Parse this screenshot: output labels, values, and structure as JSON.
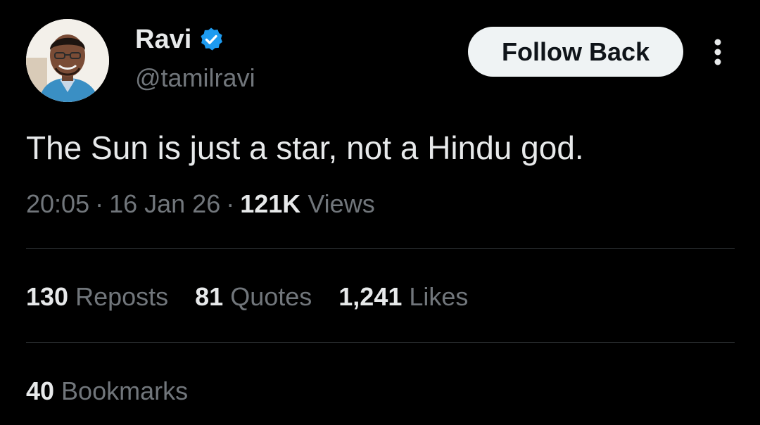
{
  "author": {
    "name": "Ravi",
    "handle": "@tamilravi",
    "verified_icon": "verified-badge-icon",
    "verified_color": "#1d9bf0"
  },
  "actions": {
    "follow_label": "Follow Back",
    "more_icon": "more-vertical-icon"
  },
  "tweet": {
    "text": "The Sun is just a star, not a Hindu god.",
    "time": "20:05",
    "date": "16 Jan 26",
    "separator": "·",
    "views_count": "121K",
    "views_label": "Views"
  },
  "stats": {
    "reposts": {
      "count": "130",
      "label": "Reposts"
    },
    "quotes": {
      "count": "81",
      "label": "Quotes"
    },
    "likes": {
      "count": "1,241",
      "label": "Likes"
    },
    "bookmarks": {
      "count": "40",
      "label": "Bookmarks"
    }
  },
  "colors": {
    "background": "#000000",
    "primary_text": "#e7e9ea",
    "secondary_text": "#71767b",
    "divider": "#2f3336",
    "button_bg": "#eff3f4"
  }
}
